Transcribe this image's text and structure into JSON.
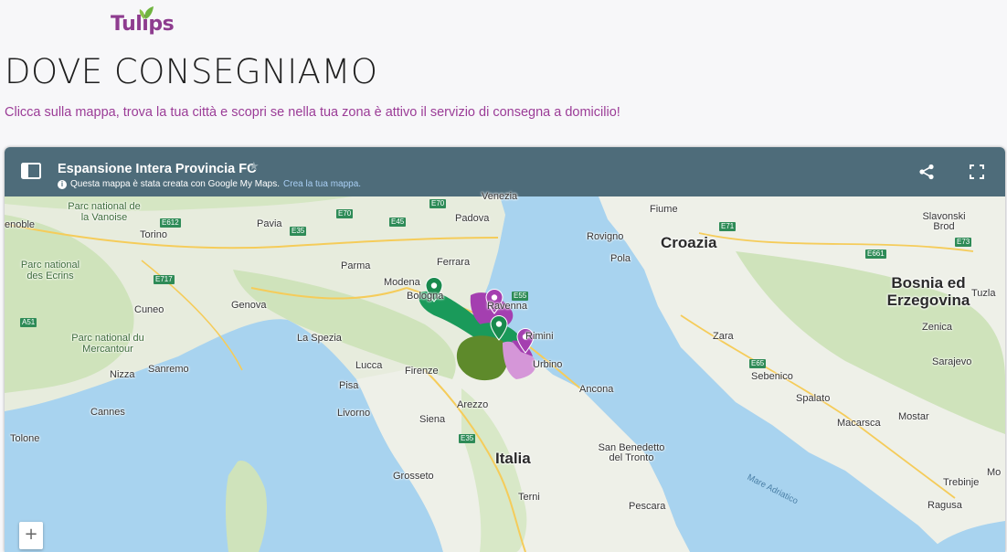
{
  "logo": {
    "text": "Tulips",
    "icon": "leaf-icon"
  },
  "page": {
    "title": "DOVE CONSEGNIAMO",
    "subtitle": "Clicca sulla mappa, trova la tua città e scopri se nella tua zona è attivo il servizio di consegna a domicilio!"
  },
  "map": {
    "title": "Espansione Intera Provincia FC",
    "credit": "Questa mappa è stata creata con Google My Maps.",
    "credit_link": "Crea la tua mappa.",
    "zoom_in": "+",
    "colors": {
      "header": "#4e6c7a",
      "green_zone": "#1a9a5a",
      "purple_zone": "#a43fb0",
      "dark_green_zone": "#5e8a2b",
      "light_purple_zone": "#d596d8",
      "sea": "#a8d3ef"
    },
    "icons": {
      "menu": "sidebar-toggle-icon",
      "star": "star-icon",
      "share": "share-icon",
      "fullscreen": "fullscreen-icon"
    },
    "countries": [
      "Croazia",
      "Bosnia ed Erzegovina",
      "Italia"
    ],
    "parks": [
      "Parc national de la Vanoise",
      "Parc national des Ecrins",
      "Parc national du Mercantour"
    ],
    "cities": [
      "Venezia",
      "Padova",
      "Fiume",
      "Rovigno",
      "Pola",
      "Torino",
      "Pavia",
      "Ferrara",
      "Parma",
      "Modena",
      "Bologna",
      "Ravenna",
      "Genova",
      "Cuneo",
      "La Spezia",
      "Firenze",
      "Lucca",
      "Pisa",
      "Livorno",
      "Siena",
      "Arezzo",
      "Grosseto",
      "Nizza",
      "Sanremo",
      "Cannes",
      "Tolone",
      "Ancona",
      "San Benedetto del Tronto",
      "Terni",
      "Pescara",
      "Zara",
      "Sebenico",
      "Spalato",
      "Macarsca",
      "Mostar",
      "Sarajevo",
      "Zenica",
      "Tuzla",
      "Slavonski Brod",
      "Trebinje",
      "Ragusa",
      "Rimini",
      "Urbino",
      "Mare Adriatico",
      "enoble",
      "Mo"
    ],
    "roads": [
      "E70",
      "E45",
      "E612",
      "E35",
      "E717",
      "E70",
      "E55",
      "A51",
      "E71",
      "E661",
      "E73",
      "E65",
      "E35"
    ],
    "markers": [
      {
        "name": "marker-bologna",
        "color": "#1a8a4e"
      },
      {
        "name": "marker-ravenna",
        "color": "#a43fb0"
      },
      {
        "name": "marker-forli",
        "color": "#1a8a4e"
      },
      {
        "name": "marker-rimini",
        "color": "#a43fb0"
      }
    ]
  }
}
